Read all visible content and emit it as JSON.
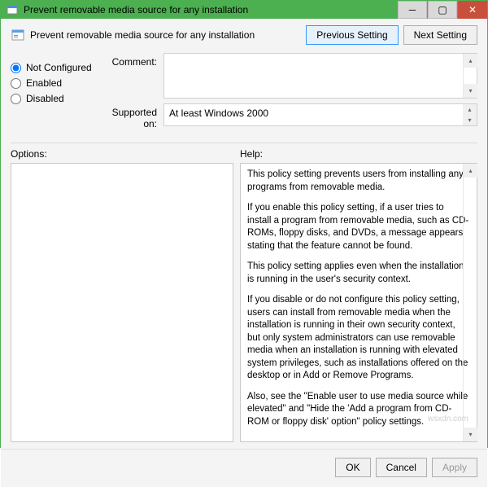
{
  "window": {
    "title": "Prevent removable media source for any installation"
  },
  "header": {
    "policy_title": "Prevent removable media source for any installation",
    "previous_label": "Previous Setting",
    "next_label": "Next Setting"
  },
  "radios": {
    "not_configured": "Not Configured",
    "enabled": "Enabled",
    "disabled": "Disabled",
    "selected": "not_configured"
  },
  "fields": {
    "comment_label": "Comment:",
    "comment_value": "",
    "supported_label": "Supported on:",
    "supported_value": "At least Windows 2000"
  },
  "panels": {
    "options_label": "Options:",
    "help_label": "Help:",
    "help_text": [
      "This policy setting prevents users from installing any programs from removable media.",
      "If you enable this policy setting, if a user tries to install a program from removable media, such as CD-ROMs, floppy disks, and DVDs, a message appears stating that the feature cannot be found.",
      "This policy setting applies even when the installation is running in the user's security context.",
      "If you disable or do not configure this policy setting, users can install from removable media when the installation is running in their own security context, but only system administrators can use removable media when an installation is running with elevated system privileges, such as installations offered on the desktop or in Add or Remove Programs.",
      "Also, see the \"Enable user to use media source while elevated\" and \"Hide the 'Add a program from CD-ROM or floppy disk' option\" policy settings."
    ]
  },
  "footer": {
    "ok": "OK",
    "cancel": "Cancel",
    "apply": "Apply"
  },
  "watermark": "wsxdn.com"
}
